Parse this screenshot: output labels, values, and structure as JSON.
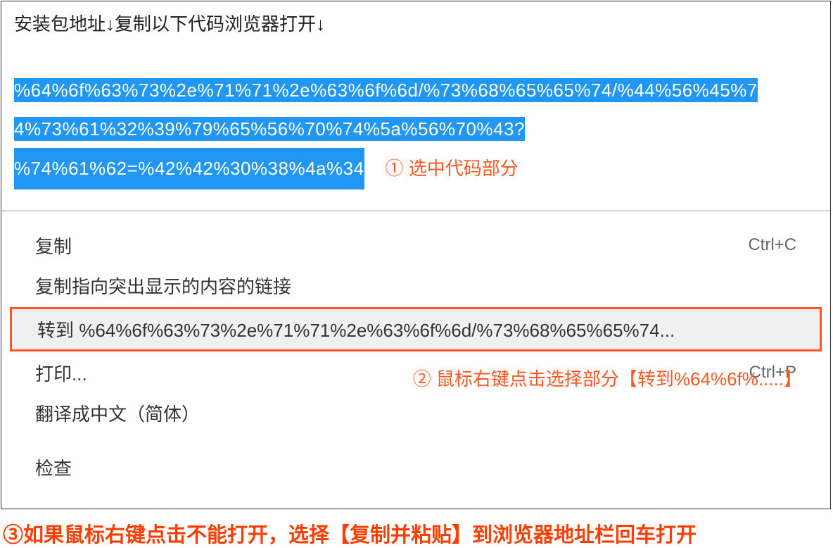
{
  "header": {
    "title": "安装包地址↓复制以下代码浏览器打开↓"
  },
  "code": {
    "line1": "%64%6f%63%73%2e%71%71%2e%63%6f%6d/%73%68%65%65%74/%44%56%45%7",
    "line2": "4%73%61%32%39%79%65%56%70%74%5a%56%70%43?",
    "line3": "%74%61%62=%42%42%30%38%4a%34"
  },
  "annotations": {
    "step1": "① 选中代码部分",
    "step2": "② 鼠标右键点击选择部分【转到%64%6f%.....】",
    "step3": "③如果鼠标右键点击不能打开，选择【复制并粘贴】到浏览器地址栏回车打开"
  },
  "contextMenu": {
    "copy": {
      "label": "复制",
      "shortcut": "Ctrl+C"
    },
    "copyLink": {
      "label": "复制指向突出显示的内容的链接"
    },
    "goto": {
      "label": "转到 %64%6f%63%73%2e%71%71%2e%63%6f%6d/%73%68%65%65%74..."
    },
    "print": {
      "label": "打印...",
      "shortcut": "Ctrl+P"
    },
    "translate": {
      "label": "翻译成中文（简体）"
    },
    "inspect": {
      "label": "检查"
    }
  }
}
